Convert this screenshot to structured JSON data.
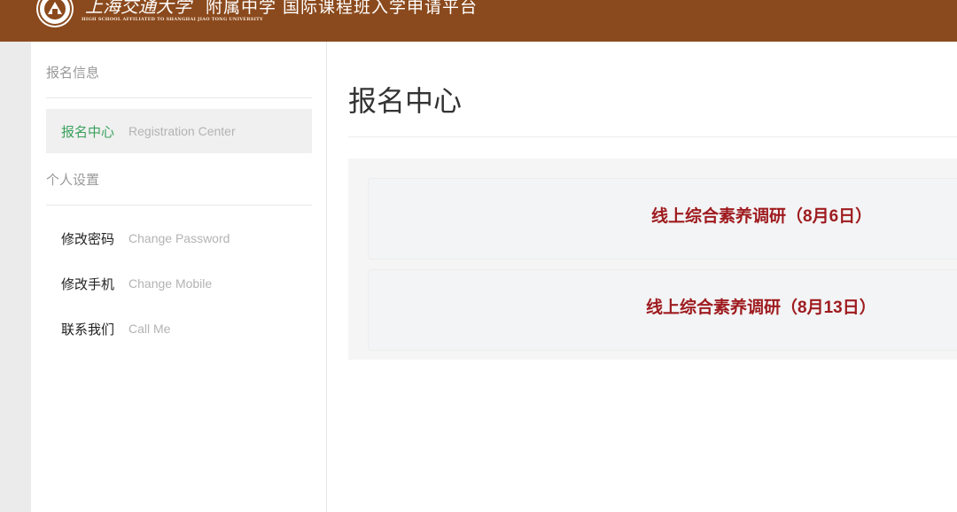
{
  "header": {
    "brand_cn": "上海交通大学",
    "brand_sub": "附属中学 国际课程班入学申请平台",
    "brand_en": "HIGH SCHOOL AFFILIATED TO SHANGHAI JIAO TONG UNIVERSITY",
    "colors": {
      "bar": "#8b4a1d"
    }
  },
  "sidebar": {
    "section1": "报名信息",
    "section2": "个人设置",
    "items": [
      {
        "cn": "报名中心",
        "en": "Registration Center",
        "active": true
      },
      {
        "cn": "修改密码",
        "en": "Change Password"
      },
      {
        "cn": "修改手机",
        "en": "Change Mobile"
      },
      {
        "cn": "联系我们",
        "en": "Call Me"
      }
    ],
    "colors": {
      "active_text": "#3aa15c"
    }
  },
  "main": {
    "title": "报名中心",
    "cards": [
      {
        "label": "线上综合素养调研（8月6日）"
      },
      {
        "label": "线上综合素养调研（8月13日）"
      }
    ],
    "colors": {
      "card_text": "#9e1b1f"
    }
  }
}
